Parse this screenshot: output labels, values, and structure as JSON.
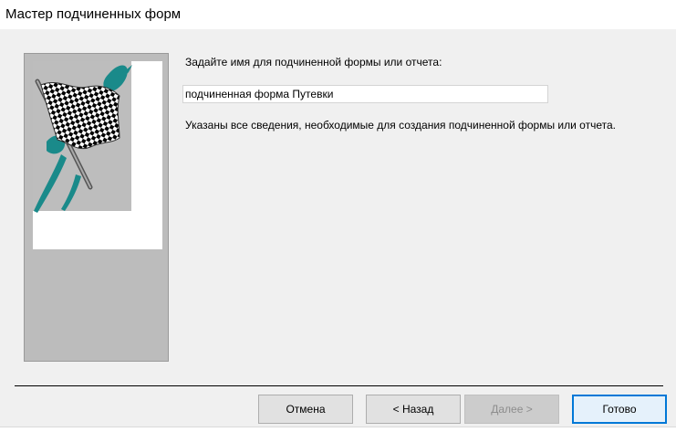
{
  "window": {
    "title": "Мастер подчиненных форм"
  },
  "side_panel": {
    "image": "checkered-flag-icon"
  },
  "form": {
    "prompt_label": "Задайте имя для подчиненной формы или отчета:",
    "name_value": "подчиненная форма Путевки",
    "info_text": "Указаны все сведения, необходимые для создания подчиненной формы или отчета."
  },
  "buttons": {
    "cancel": "Отмена",
    "back": "< Назад",
    "next": "Далее >",
    "finish": "Готово"
  },
  "colors": {
    "flag_accent": "#1a8a8a",
    "default_button_border": "#0078d7"
  }
}
